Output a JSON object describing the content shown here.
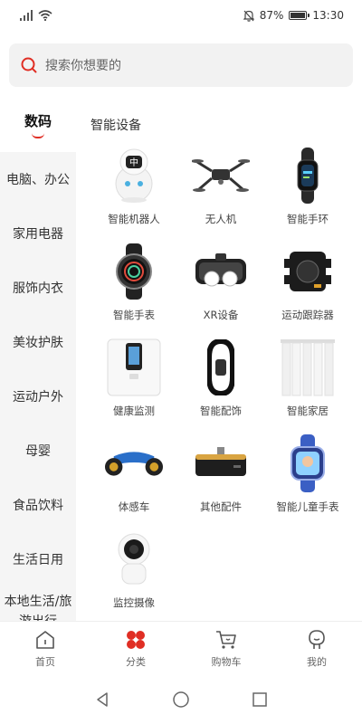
{
  "status_bar": {
    "battery": "87%",
    "time": "13:30",
    "battery_level": 0.87
  },
  "search": {
    "placeholder": "搜索你想要的"
  },
  "sidebar": {
    "items": [
      {
        "label": "数码",
        "active": true
      },
      {
        "label": "电脑、办公"
      },
      {
        "label": "家用电器"
      },
      {
        "label": "服饰内衣"
      },
      {
        "label": "美妆护肤"
      },
      {
        "label": "运动户外"
      },
      {
        "label": "母婴"
      },
      {
        "label": "食品饮料"
      },
      {
        "label": "生活日用"
      },
      {
        "label": "本地生活/旅游出行"
      }
    ]
  },
  "content": {
    "section_title": "智能设备",
    "items": [
      {
        "label": "智能机器人",
        "icon": "robot-icon"
      },
      {
        "label": "无人机",
        "icon": "drone-icon"
      },
      {
        "label": "智能手环",
        "icon": "smart-band-icon"
      },
      {
        "label": "智能手表",
        "icon": "smart-watch-icon"
      },
      {
        "label": "XR设备",
        "icon": "vr-headset-icon"
      },
      {
        "label": "运动跟踪器",
        "icon": "sport-tracker-icon"
      },
      {
        "label": "健康监测",
        "icon": "health-scale-icon"
      },
      {
        "label": "智能配饰",
        "icon": "smart-accessory-icon"
      },
      {
        "label": "智能家居",
        "icon": "smart-curtain-icon"
      },
      {
        "label": "体感车",
        "icon": "hoverboard-icon"
      },
      {
        "label": "其他配件",
        "icon": "accessory-icon"
      },
      {
        "label": "智能儿童手表",
        "icon": "kids-watch-icon"
      },
      {
        "label": "监控摄像",
        "icon": "camera-icon"
      }
    ]
  },
  "bottom_nav": {
    "items": [
      {
        "label": "首页",
        "icon": "home-icon"
      },
      {
        "label": "分类",
        "icon": "category-icon",
        "active": true
      },
      {
        "label": "购物车",
        "icon": "cart-icon"
      },
      {
        "label": "我的",
        "icon": "profile-icon"
      }
    ]
  },
  "colors": {
    "accent": "#e02e24",
    "sidebar_bg": "#f5f5f5",
    "search_bg": "#f2f2f2"
  }
}
